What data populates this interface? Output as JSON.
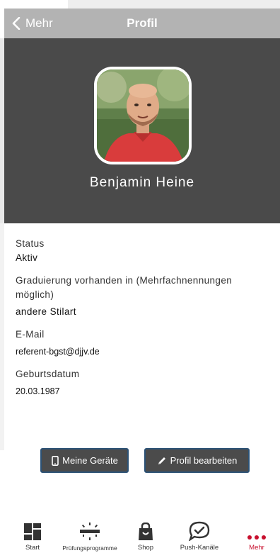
{
  "navbar": {
    "back_label": "Mehr",
    "title": "Profil"
  },
  "profile": {
    "name": "Benjamin Heine",
    "avatar": "profile-photo"
  },
  "info": [
    {
      "label": "Status",
      "value": "Aktiv"
    },
    {
      "label": "Graduierung vorhanden in (Mehrfachnennungen möglich)",
      "value": "andere Stilart"
    },
    {
      "label": "E-Mail",
      "value": "referent-bgst@djjv.de"
    },
    {
      "label": "Geburtsdatum",
      "value": "20.03.1987"
    }
  ],
  "actions": {
    "devices_label": "Meine Geräte",
    "devices_icon": "phone-icon",
    "edit_label": "Profil bearbeiten",
    "edit_icon": "pencil-icon"
  },
  "tabs": [
    {
      "label": "Start",
      "icon": "dashboard-icon"
    },
    {
      "label": "Prüfungsprogramme",
      "icon": "belt-icon"
    },
    {
      "label": "Shop",
      "icon": "shopping-bag-icon"
    },
    {
      "label": "Push-Kanäle",
      "icon": "chat-check-icon"
    },
    {
      "label": "Mehr",
      "icon": "more-dots-icon",
      "active": true
    }
  ],
  "colors": {
    "navbar": "#b3b3b3",
    "header": "#4a4a4a",
    "button_bg": "#4b4b4b",
    "button_border": "#2c5276",
    "active_tab": "#c8102e"
  }
}
